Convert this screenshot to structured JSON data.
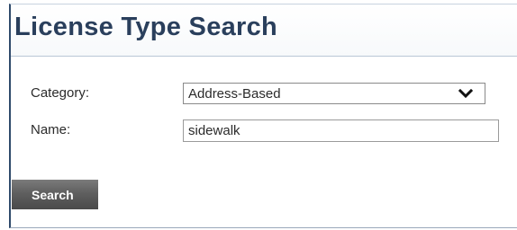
{
  "page": {
    "title": "License Type Search"
  },
  "form": {
    "category_label": "Category:",
    "category_value": "Address-Based",
    "name_label": "Name:",
    "name_value": "sidewalk",
    "search_label": "Search"
  },
  "icons": {
    "category_dropdown": "chevron-down-icon"
  },
  "colors": {
    "title": "#2a3f5c",
    "panel_border": "#2f4a6b",
    "button": "#5f5f5f"
  }
}
